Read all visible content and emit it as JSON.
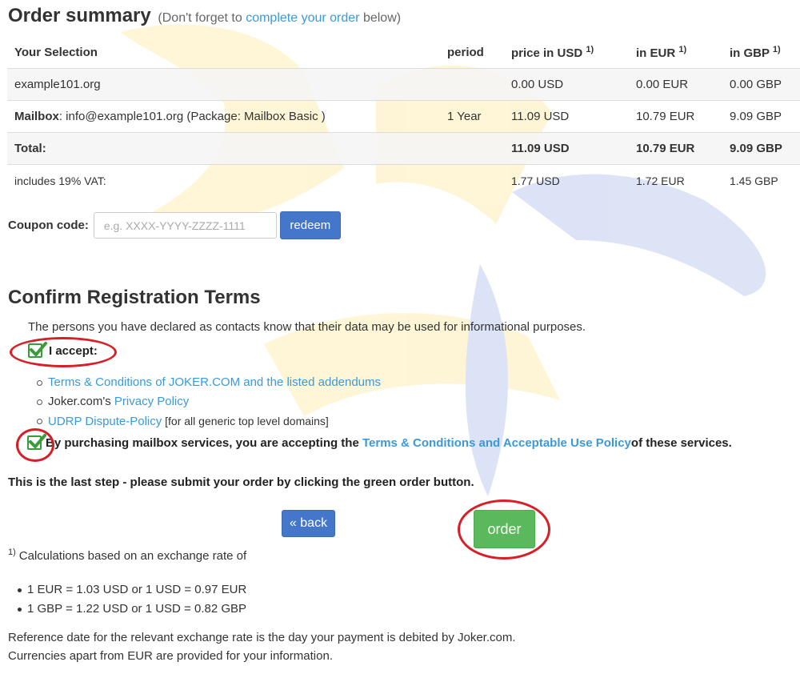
{
  "summary": {
    "title": "Order summary",
    "subtitle_prefix": "(Don't forget to ",
    "subtitle_link": "complete your order",
    "subtitle_suffix": " below)"
  },
  "table": {
    "headers": {
      "selection": "Your Selection",
      "period": "period",
      "usd": "price in USD",
      "eur": "in EUR",
      "gbp": "in GBP",
      "footnote_mark": "1)"
    },
    "rows": [
      {
        "selection": "example101.org",
        "period": "",
        "usd": "0.00 USD",
        "eur": "0.00 EUR",
        "gbp": "0.00 GBP"
      },
      {
        "selection_bold": "Mailbox",
        "selection": ": info@example101.org (Package: Mailbox Basic )",
        "period": "1 Year",
        "usd": "11.09 USD",
        "eur": "10.79 EUR",
        "gbp": "9.09 GBP"
      }
    ],
    "total": {
      "label": "Total:",
      "usd": "11.09 USD",
      "eur": "10.79 EUR",
      "gbp": "9.09 GBP"
    },
    "vat": {
      "label": "includes 19% VAT:",
      "usd": "1.77 USD",
      "eur": "1.72 EUR",
      "gbp": "1.45 GBP"
    }
  },
  "coupon": {
    "label": "Coupon code:",
    "value": "",
    "placeholder": "e.g. XXXX-YYYY-ZZZZ-1111",
    "button": "redeem"
  },
  "terms": {
    "title": "Confirm Registration Terms",
    "intro": "The persons you have declared as contacts know that their data may be used for informational purposes.",
    "accept_label": "I accept:",
    "accept_checked": true,
    "items": [
      {
        "link": "Terms & Conditions of JOKER.COM and the listed addendums",
        "suffix": ""
      },
      {
        "prefix": "Joker.com's ",
        "link": "Privacy Policy"
      },
      {
        "link": "UDRP Dispute-Policy",
        "suffix": " [for all generic top level domains]"
      }
    ],
    "mailbox_checked": true,
    "mailbox_prefix": "By purchasing mailbox services, you are accepting the ",
    "mailbox_link": "Terms & Conditions and Acceptable Use Policy",
    "mailbox_suffix": " of these services."
  },
  "last_step": "This is the last step - please submit your order by clicking the green order button.",
  "buttons": {
    "back": "« back",
    "order": "order"
  },
  "colors": {
    "link": "#3a9ad9",
    "blue_button": "#4477c9",
    "order_button": "#5cb85c",
    "highlight_ring": "#d61f26",
    "checkbox": "#3b9a3b"
  },
  "footnote": {
    "mark": "1)",
    "text": "Calculations based on an exchange rate of",
    "rates": [
      "1 EUR = 1.03 USD or 1 USD = 0.97 EUR",
      "1 GBP = 1.22 USD or 1 USD = 0.82 GBP"
    ],
    "ref_line1": "Reference date for the relevant exchange rate is the day your payment is debited by Joker.com.",
    "ref_line2": "Currencies apart from EUR are provided for your information."
  }
}
